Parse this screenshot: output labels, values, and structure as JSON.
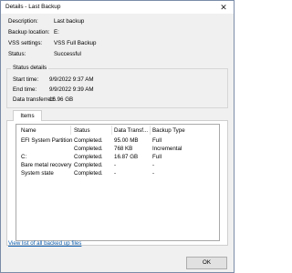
{
  "window": {
    "title": "Details - Last Backup",
    "close_glyph": "✕"
  },
  "summary": [
    {
      "label": "Description:",
      "value": "Last backup"
    },
    {
      "label": "Backup location:",
      "value": "E:"
    },
    {
      "label": "VSS settings:",
      "value": "VSS Full Backup"
    },
    {
      "label": "Status:",
      "value": "Successful"
    }
  ],
  "status_details": {
    "title": "Status details",
    "rows": [
      {
        "label": "Start time:",
        "value": "9/9/2022 9:37 AM"
      },
      {
        "label": "End time:",
        "value": "9/9/2022 9:39 AM"
      },
      {
        "label": "Data transferred:",
        "value": "16.96 GB"
      }
    ]
  },
  "items": {
    "tab_label": "Items",
    "columns": [
      "Name",
      "Status",
      "Data Transf...",
      "Backup Type"
    ],
    "rows": [
      {
        "name": "EFI System Partition",
        "status": "Completed.",
        "data": "95.00 MB",
        "type": "Full"
      },
      {
        "name": "",
        "status": "Completed.",
        "data": "768 KB",
        "type": "Incremental"
      },
      {
        "name": "C:",
        "status": "Completed.",
        "data": "16.87 GB",
        "type": "Full"
      },
      {
        "name": "Bare metal recovery",
        "status": "Completed.",
        "data": "-",
        "type": "-"
      },
      {
        "name": "System state",
        "status": "Completed.",
        "data": "-",
        "type": "-"
      }
    ]
  },
  "footer": {
    "link_text": "View list of all backed up files",
    "ok_label": "OK"
  },
  "colors": {
    "link": "#0b5cad",
    "window_bg": "#f0f0f0",
    "panel_bg": "#ffffff"
  }
}
